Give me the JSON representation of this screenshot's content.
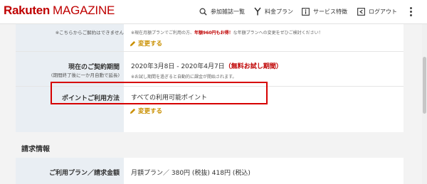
{
  "header": {
    "logo_rakuten": "Rakuten",
    "logo_magazine": "MAGAZINE",
    "nav": [
      {
        "label": "参加雑誌一覧",
        "icon": "search-icon"
      },
      {
        "label": "料金プラン",
        "icon": "price-icon"
      },
      {
        "label": "サービス特徴",
        "icon": "info-icon"
      },
      {
        "label": "ログアウト",
        "icon": "logout-icon"
      }
    ]
  },
  "plan_row": {
    "label_sub": "※こちらからご解約はできません",
    "note_line1": "※現在月額プランでご利用の方、",
    "note_highlight": "年額960円もお得！",
    "note_line2": "な年額プランへの変更をぜひご検討ください！",
    "change_label": "変更する"
  },
  "contract_row": {
    "label": "現在のご契約期間",
    "label_sub": "(期間終了後に一か月自動で延長)",
    "period": "2020年3月8日 - 2020年4月7日",
    "trial": "（無料お試し期間）",
    "note": "※お試し期間を過ぎると自動的に課金が開始されます。"
  },
  "points_row": {
    "label": "ポイントご利用方法",
    "value": "すべての利用可能ポイント",
    "change_label": "変更する"
  },
  "billing": {
    "section_title": "請求情報",
    "label": "ご利用プラン／請求金額",
    "value": "月額プラン／ 380円 (税抜) 418円 (税込)"
  },
  "colors": {
    "brand": "#bf0000",
    "accent": "#c98f00",
    "highlight_box": "#d60000",
    "label_bg": "#e9eef3"
  }
}
